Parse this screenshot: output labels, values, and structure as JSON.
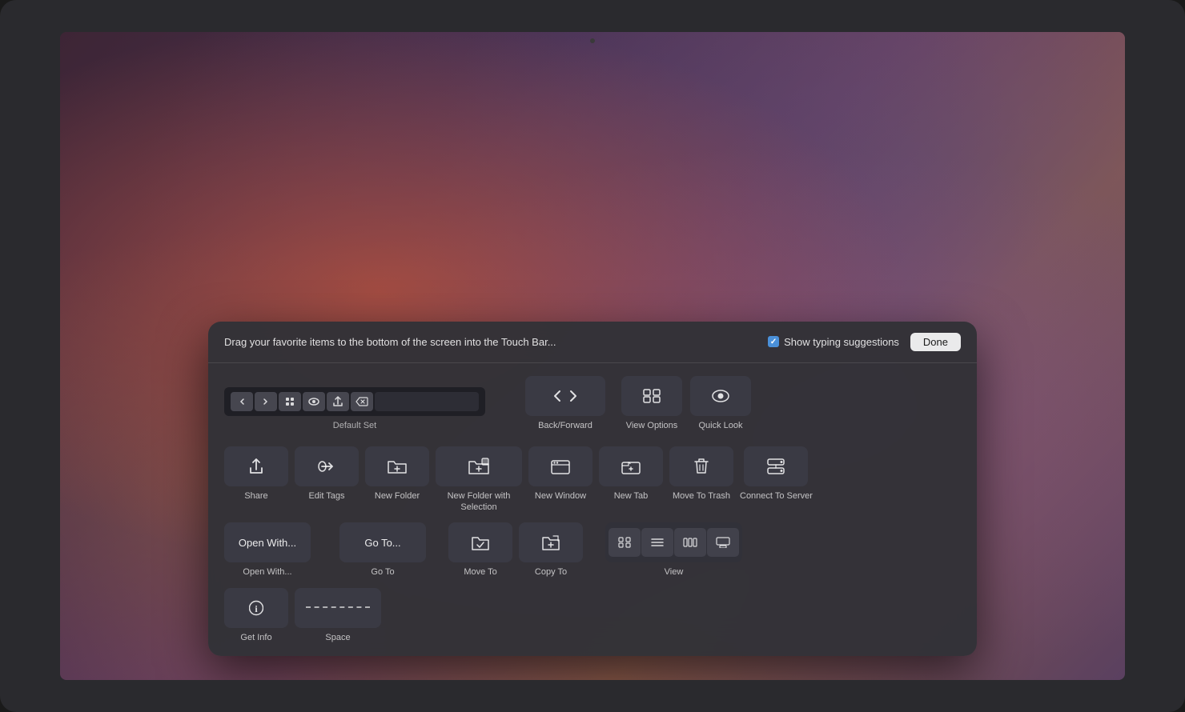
{
  "header": {
    "instruction": "Drag your favorite items to the bottom of the screen into the Touch Bar...",
    "show_typing_label": "Show typing suggestions",
    "done_label": "Done"
  },
  "touchbar": {
    "default_label": "Default Set",
    "back_forward_label": "Back/Forward",
    "view_options_label": "View Options",
    "quick_look_label": "Quick Look"
  },
  "items": {
    "row1": [
      {
        "label": "Share",
        "icon": "share"
      },
      {
        "label": "Edit Tags",
        "icon": "tag"
      },
      {
        "label": "New Folder",
        "icon": "folder-new"
      },
      {
        "label": "New Folder with Selection",
        "icon": "folder-new-sel"
      },
      {
        "label": "New Window",
        "icon": "window"
      },
      {
        "label": "New Tab",
        "icon": "tab"
      },
      {
        "label": "Move To Trash",
        "icon": "trash"
      },
      {
        "label": "Connect To Server",
        "icon": "server"
      }
    ],
    "row2": [
      {
        "label": "Open With...",
        "text": "Open With...",
        "type": "text"
      },
      {
        "label": "Go To",
        "text": "Go To...",
        "type": "text"
      },
      {
        "label": "Move To",
        "icon": "move"
      },
      {
        "label": "Copy To",
        "icon": "copy"
      },
      {
        "label": "View",
        "type": "view"
      }
    ],
    "row3": [
      {
        "label": "Get Info",
        "icon": "info"
      },
      {
        "label": "Space",
        "type": "space"
      }
    ]
  }
}
